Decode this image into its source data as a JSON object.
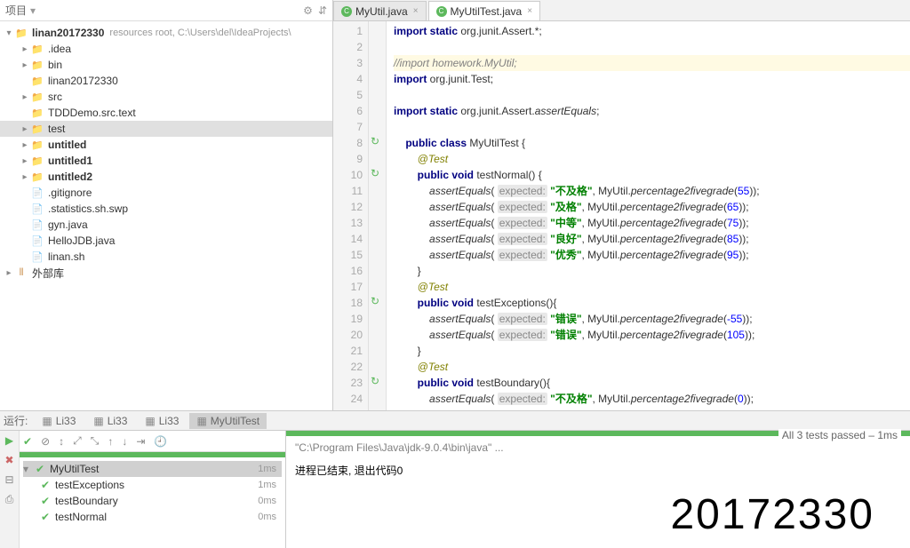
{
  "project_header": {
    "label": "项目",
    "gear": "⚙",
    "arrow": "⇵"
  },
  "tree": {
    "root": {
      "name": "linan20172330",
      "hint": "resources root,  C:\\Users\\del\\IdeaProjects\\"
    },
    "items": [
      {
        "indent": 1,
        "arrow": "▸",
        "icon": "folder-y",
        "label": ".idea"
      },
      {
        "indent": 1,
        "arrow": "▸",
        "icon": "folder-y",
        "label": "bin"
      },
      {
        "indent": 1,
        "arrow": " ",
        "icon": "folder-b",
        "label": "linan20172330"
      },
      {
        "indent": 1,
        "arrow": "▸",
        "icon": "folder-b",
        "label": "src"
      },
      {
        "indent": 1,
        "arrow": " ",
        "icon": "folder-p",
        "label": "TDDDemo.src.text"
      },
      {
        "indent": 1,
        "arrow": "▸",
        "icon": "folder-g",
        "label": "test",
        "sel": true
      },
      {
        "indent": 1,
        "arrow": "▸",
        "icon": "folder-b",
        "label": "untitled",
        "bold": true
      },
      {
        "indent": 1,
        "arrow": "▸",
        "icon": "folder-b",
        "label": "untitled1",
        "bold": true
      },
      {
        "indent": 1,
        "arrow": "▸",
        "icon": "folder-b",
        "label": "untitled2",
        "bold": true
      },
      {
        "indent": 1,
        "arrow": " ",
        "icon": "file-i",
        "label": ".gitignore"
      },
      {
        "indent": 1,
        "arrow": " ",
        "icon": "file-i",
        "label": ".statistics.sh.swp"
      },
      {
        "indent": 1,
        "arrow": " ",
        "icon": "file-i",
        "label": "gyn.java"
      },
      {
        "indent": 1,
        "arrow": " ",
        "icon": "file-i",
        "label": "HelloJDB.java"
      },
      {
        "indent": 1,
        "arrow": " ",
        "icon": "file-i",
        "label": "linan.sh"
      }
    ],
    "ext": {
      "arrow": "▸",
      "label": "外部库"
    }
  },
  "tabs": [
    {
      "label": "MyUtil.java",
      "active": false
    },
    {
      "label": "MyUtilTest.java",
      "active": true
    }
  ],
  "lines": [
    "1",
    "2",
    "3",
    "4",
    "5",
    "6",
    "7",
    "8",
    "9",
    "10",
    "11",
    "12",
    "13",
    "14",
    "15",
    "16",
    "17",
    "18",
    "19",
    "20",
    "21",
    "22",
    "23",
    "24"
  ],
  "code": {
    "l1": {
      "a": "import static",
      "b": " org.junit.Assert.*;"
    },
    "l3": "//import homework.MyUtil;",
    "l4": {
      "a": "import",
      "b": " org.junit.Test;"
    },
    "l6": {
      "a": "import static",
      "b": " org.junit.Assert.",
      "c": "assertEquals",
      "d": ";"
    },
    "l8": {
      "a": "public class",
      "b": " MyUtilTest {"
    },
    "l9": "@Test",
    "l10": {
      "a": "public void",
      "b": " testNormal() {"
    },
    "l11": {
      "fn": "assertEquals",
      "h": "expected:",
      "s": "\"不及格\"",
      "m": ", MyUtil.",
      "f2": "percentage2fivegrade",
      "n": "55"
    },
    "l12": {
      "fn": "assertEquals",
      "h": "expected:",
      "s": "\"及格\"",
      "m": ", MyUtil.",
      "f2": "percentage2fivegrade",
      "n": "65"
    },
    "l13": {
      "fn": "assertEquals",
      "h": "expected:",
      "s": "\"中等\"",
      "m": ", MyUtil.",
      "f2": "percentage2fivegrade",
      "n": "75"
    },
    "l14": {
      "fn": "assertEquals",
      "h": "expected:",
      "s": "\"良好\"",
      "m": ", MyUtil.",
      "f2": "percentage2fivegrade",
      "n": "85"
    },
    "l15": {
      "fn": "assertEquals",
      "h": "expected:",
      "s": "\"优秀\"",
      "m": ", MyUtil.",
      "f2": "percentage2fivegrade",
      "n": "95"
    },
    "l16": "}",
    "l17": "@Test",
    "l18": {
      "a": "public void",
      "b": " testExceptions(){"
    },
    "l19": {
      "fn": "assertEquals",
      "h": "expected:",
      "s": "\"错误\"",
      "m": ", MyUtil.",
      "f2": "percentage2fivegrade",
      "n": "-55"
    },
    "l20": {
      "fn": "assertEquals",
      "h": "expected:",
      "s": "\"错误\"",
      "m": ", MyUtil.",
      "f2": "percentage2fivegrade",
      "n": "105"
    },
    "l21": "}",
    "l22": "@Test",
    "l23": {
      "a": "public void",
      "b": " testBoundary(){"
    },
    "l24": {
      "fn": "assertEquals",
      "h": "expected:",
      "s": "\"不及格\"",
      "m": ", MyUtil.",
      "f2": "percentage2fivegrade",
      "n": "0"
    }
  },
  "run": {
    "label": "运行:",
    "tabs": [
      {
        "l": "Li33"
      },
      {
        "l": "Li33"
      },
      {
        "l": "Li33"
      },
      {
        "l": "MyUtilTest",
        "active": true
      }
    ],
    "pass": "All 3 tests passed",
    "passtime": " – 1ms"
  },
  "tests": [
    {
      "indent": 0,
      "label": "MyUtilTest",
      "time": "1ms",
      "sel": true,
      "arrow": "▾"
    },
    {
      "indent": 1,
      "label": "testExceptions",
      "time": "1ms"
    },
    {
      "indent": 1,
      "label": "testBoundary",
      "time": "0ms"
    },
    {
      "indent": 1,
      "label": "testNormal",
      "time": "0ms"
    }
  ],
  "console": {
    "path": "\"C:\\Program Files\\Java\\jdk-9.0.4\\bin\\java\" ...",
    "exit": "进程已结束, 退出代码0"
  },
  "watermark": "20172330"
}
